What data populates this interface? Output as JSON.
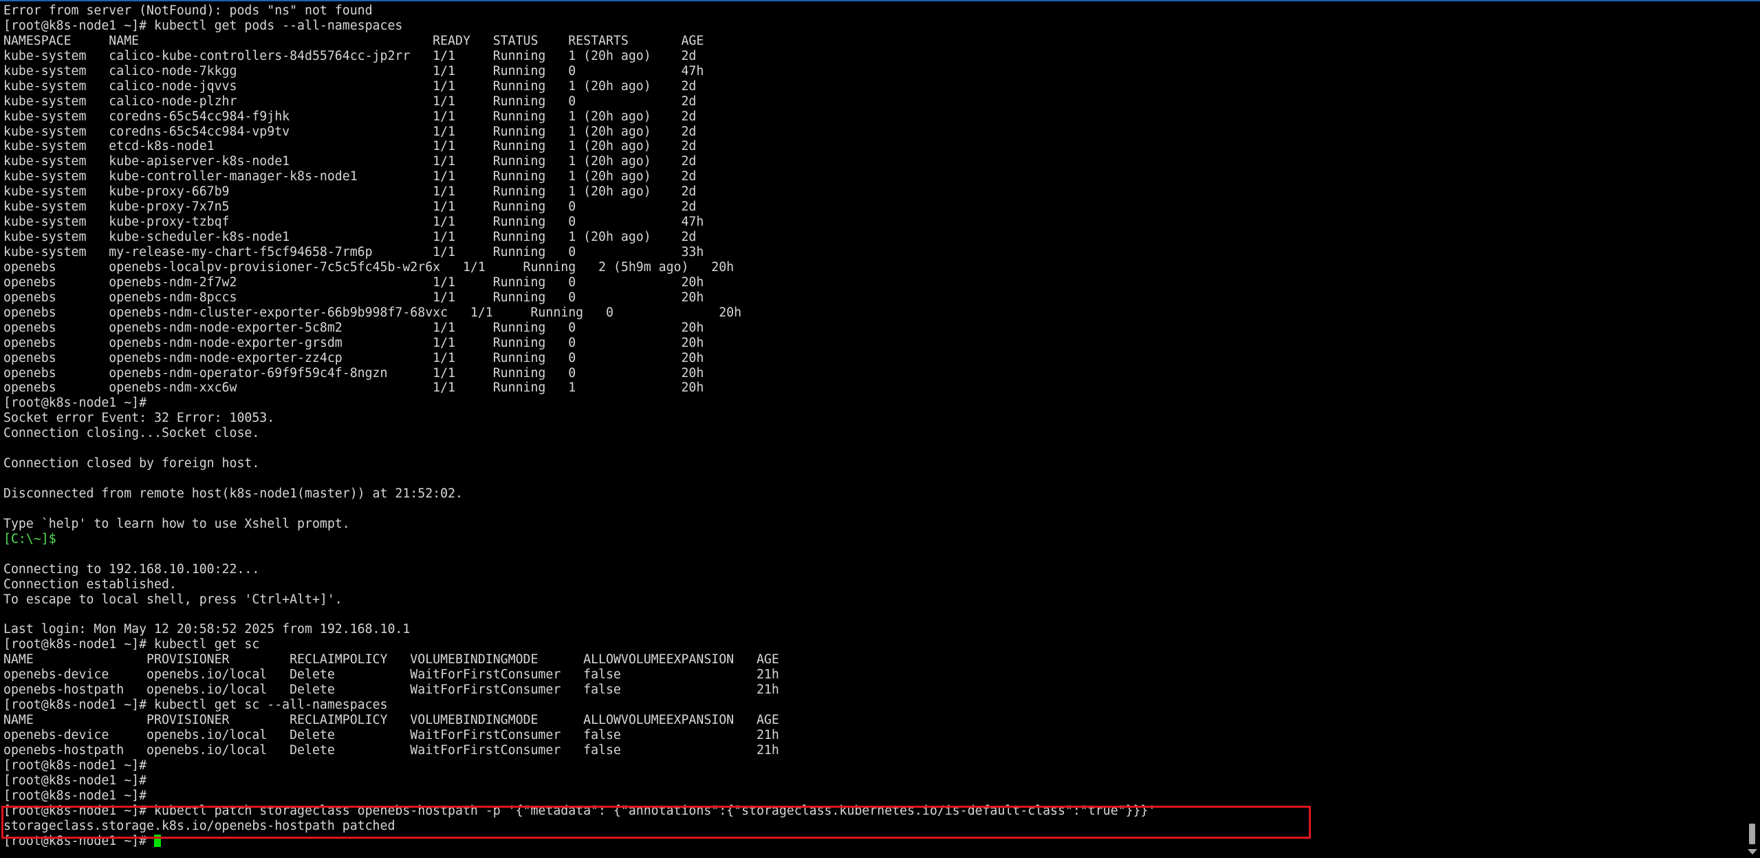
{
  "terminal": {
    "lines": [
      "Error from server (NotFound): pods \"ns\" not found",
      "[root@k8s-node1 ~]# kubectl get pods --all-namespaces",
      "NAMESPACE     NAME                                       READY   STATUS    RESTARTS       AGE",
      "kube-system   calico-kube-controllers-84d55764cc-jp2rr   1/1     Running   1 (20h ago)    2d",
      "kube-system   calico-node-7kkgg                          1/1     Running   0              47h",
      "kube-system   calico-node-jqvvs                          1/1     Running   1 (20h ago)    2d",
      "kube-system   calico-node-plzhr                          1/1     Running   0              2d",
      "kube-system   coredns-65c54cc984-f9jhk                   1/1     Running   1 (20h ago)    2d",
      "kube-system   coredns-65c54cc984-vp9tv                   1/1     Running   1 (20h ago)    2d",
      "kube-system   etcd-k8s-node1                             1/1     Running   1 (20h ago)    2d",
      "kube-system   kube-apiserver-k8s-node1                   1/1     Running   1 (20h ago)    2d",
      "kube-system   kube-controller-manager-k8s-node1          1/1     Running   1 (20h ago)    2d",
      "kube-system   kube-proxy-667b9                           1/1     Running   1 (20h ago)    2d",
      "kube-system   kube-proxy-7x7n5                           1/1     Running   0              2d",
      "kube-system   kube-proxy-tzbqf                           1/1     Running   0              47h",
      "kube-system   kube-scheduler-k8s-node1                   1/1     Running   1 (20h ago)    2d",
      "kube-system   my-release-my-chart-f5cf94658-7rm6p        1/1     Running   0              33h",
      "openebs       openebs-localpv-provisioner-7c5c5fc45b-w2r6x   1/1     Running   2 (5h9m ago)   20h",
      "openebs       openebs-ndm-2f7w2                          1/1     Running   0              20h",
      "openebs       openebs-ndm-8pccs                          1/1     Running   0              20h",
      "openebs       openebs-ndm-cluster-exporter-66b9b998f7-68vxc   1/1     Running   0              20h",
      "openebs       openebs-ndm-node-exporter-5c8m2            1/1     Running   0              20h",
      "openebs       openebs-ndm-node-exporter-grsdm            1/1     Running   0              20h",
      "openebs       openebs-ndm-node-exporter-zz4cp            1/1     Running   0              20h",
      "openebs       openebs-ndm-operator-69f9f59c4f-8ngzn      1/1     Running   0              20h",
      "openebs       openebs-ndm-xxc6w                          1/1     Running   1              20h",
      "[root@k8s-node1 ~]#",
      "Socket error Event: 32 Error: 10053.",
      "Connection closing...Socket close.",
      "",
      "Connection closed by foreign host.",
      "",
      "Disconnected from remote host(k8s-node1(master)) at 21:52:02.",
      "",
      "Type `help' to learn how to use Xshell prompt.",
      "[C:\\~]$",
      "",
      "Connecting to 192.168.10.100:22...",
      "Connection established.",
      "To escape to local shell, press 'Ctrl+Alt+]'.",
      "",
      "Last login: Mon May 12 20:58:52 2025 from 192.168.10.1",
      "[root@k8s-node1 ~]# kubectl get sc",
      "NAME               PROVISIONER        RECLAIMPOLICY   VOLUMEBINDINGMODE      ALLOWVOLUMEEXPANSION   AGE",
      "openebs-device     openebs.io/local   Delete          WaitForFirstConsumer   false                  21h",
      "openebs-hostpath   openebs.io/local   Delete          WaitForFirstConsumer   false                  21h",
      "[root@k8s-node1 ~]# kubectl get sc --all-namespaces",
      "NAME               PROVISIONER        RECLAIMPOLICY   VOLUMEBINDINGMODE      ALLOWVOLUMEEXPANSION   AGE",
      "openebs-device     openebs.io/local   Delete          WaitForFirstConsumer   false                  21h",
      "openebs-hostpath   openebs.io/local   Delete          WaitForFirstConsumer   false                  21h",
      "[root@k8s-node1 ~]#",
      "[root@k8s-node1 ~]#",
      "[root@k8s-node1 ~]#",
      "[root@k8s-node1 ~]# kubectl patch storageclass openebs-hostpath -p '{\"metadata\": {\"annotations\":{\"storageclass.kubernetes.io/is-default-class\":\"true\"}}}'",
      "storageclass.storage.k8s.io/openebs-hostpath patched",
      "[root@k8s-node1 ~]# "
    ],
    "local_prompt_line_index": 35,
    "cursor_line_index": 55
  },
  "colors": {
    "background": "#000000",
    "text": "#d7d7d7",
    "local_prompt": "#55e055",
    "cursor": "#00e000",
    "highlight_box": "#e0141b",
    "scrollbar_thumb": "#a8a8a8"
  },
  "icons": {
    "scroll_down": "scroll-down-arrow-icon"
  }
}
